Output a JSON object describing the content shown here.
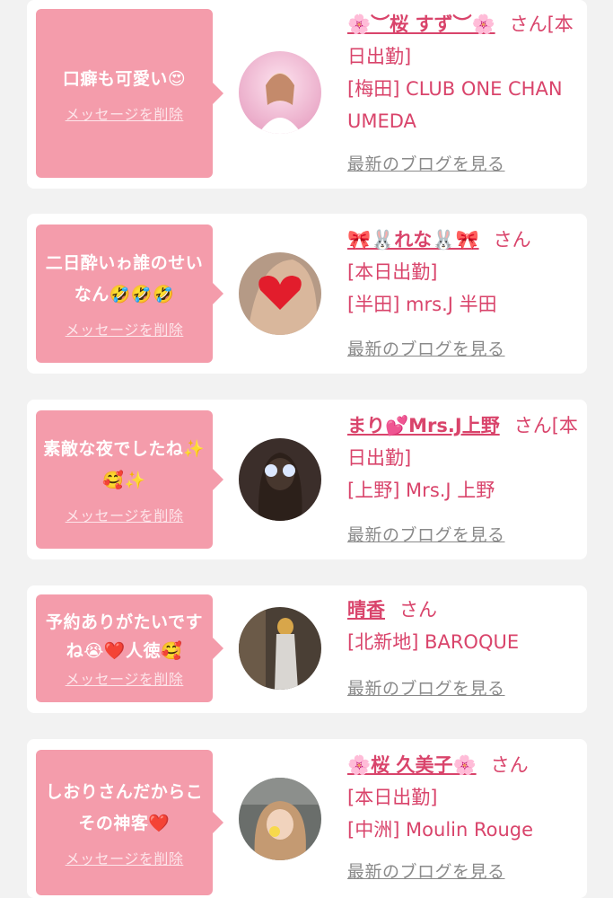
{
  "colors": {
    "accent": "#d9446b",
    "bubble": "#f49cab",
    "background": "#f2f2f2"
  },
  "delete_label": "メッセージを削除",
  "blog_label": "最新のブログを見る",
  "san": "さん",
  "cards": [
    {
      "message": "口癖も可愛い😍",
      "name": "🌸︶桜 すず︶🌸",
      "status": "[本日出勤]",
      "shop": "[梅田] CLUB ONE CHAN UMEDA"
    },
    {
      "message": "二日酔いゎ誰のせいなん🤣🤣🤣",
      "name": "🎀🐰れな🐰🎀",
      "status": "[本日出勤]",
      "shop": "[半田] mrs.J 半田"
    },
    {
      "message": "素敵な夜でしたね✨🥰✨",
      "name": "まり💕Mrs.J上野",
      "status": "[本日出勤]",
      "shop": "[上野] Mrs.J 上野"
    },
    {
      "message": "予約ありがたいですね😭❤️人徳🥰",
      "name": "晴香",
      "status": "",
      "shop": "[北新地] BAROQUE"
    },
    {
      "message": "しおりさんだからこその神客❤️",
      "name": "🌸桜 久美子🌸",
      "status": "[本日出勤]",
      "shop": "[中洲] Moulin Rouge"
    }
  ]
}
